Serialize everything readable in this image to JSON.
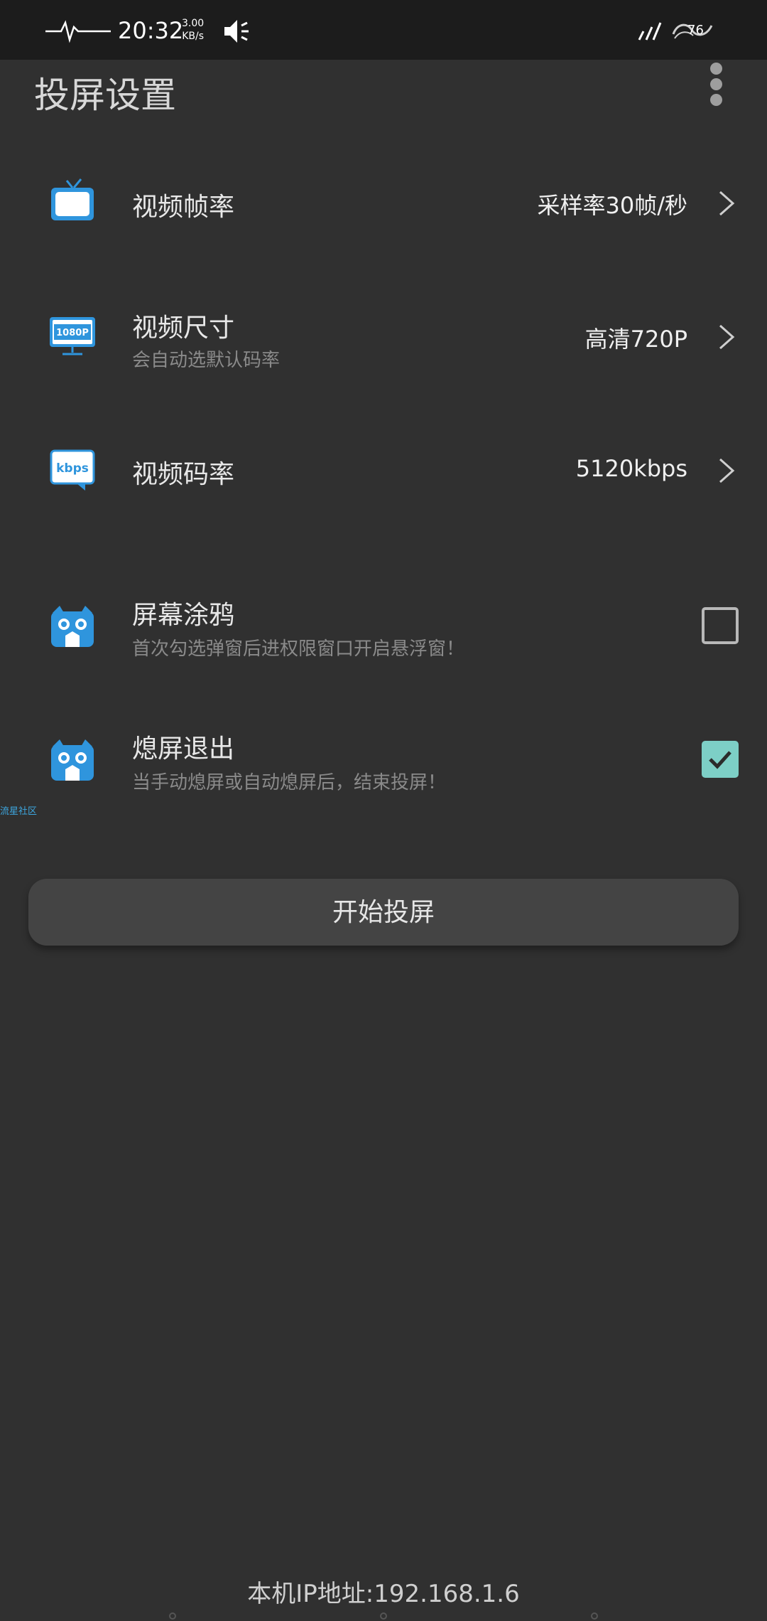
{
  "status_bar": {
    "time": "20:32",
    "speed_value": "3.00",
    "speed_unit": "KB/s",
    "battery": "76",
    "icons": [
      "heartbeat-icon",
      "speaker-icon",
      "signal-icon",
      "battery-icon"
    ]
  },
  "header": {
    "title": "投屏设置",
    "menu_icon": "more-vertical-icon"
  },
  "settings": {
    "frame_rate": {
      "title": "视频帧率",
      "value": "采样率30帧/秒",
      "icon": "tv-icon"
    },
    "video_size": {
      "title": "视频尺寸",
      "subtitle": "会自动选默认码率",
      "value": "高清720P",
      "icon": "monitor-1080p-icon",
      "icon_text": "1080P"
    },
    "bitrate": {
      "title": "视频码率",
      "value": "5120kbps",
      "icon": "kbps-icon",
      "icon_text": "kbps"
    },
    "graffiti": {
      "title": "屏幕涂鸦",
      "subtitle": "首次勾选弹窗后进权限窗口开启悬浮窗！",
      "checked": false,
      "icon": "mascot-icon"
    },
    "screen_off_exit": {
      "title": "熄屏退出",
      "subtitle": "当手动熄屏或自动熄屏后，结束投屏！",
      "checked": true,
      "icon": "mascot-icon"
    }
  },
  "watermark": "流星社区",
  "start_button": "开始投屏",
  "ip_label": "本机IP地址:192.168.1.6",
  "colors": {
    "background": "#303030",
    "status_bar": "#1c1c1c",
    "accent_icon": "#2f95dd",
    "checkbox_checked": "#7dcfc6",
    "button": "#444444"
  }
}
